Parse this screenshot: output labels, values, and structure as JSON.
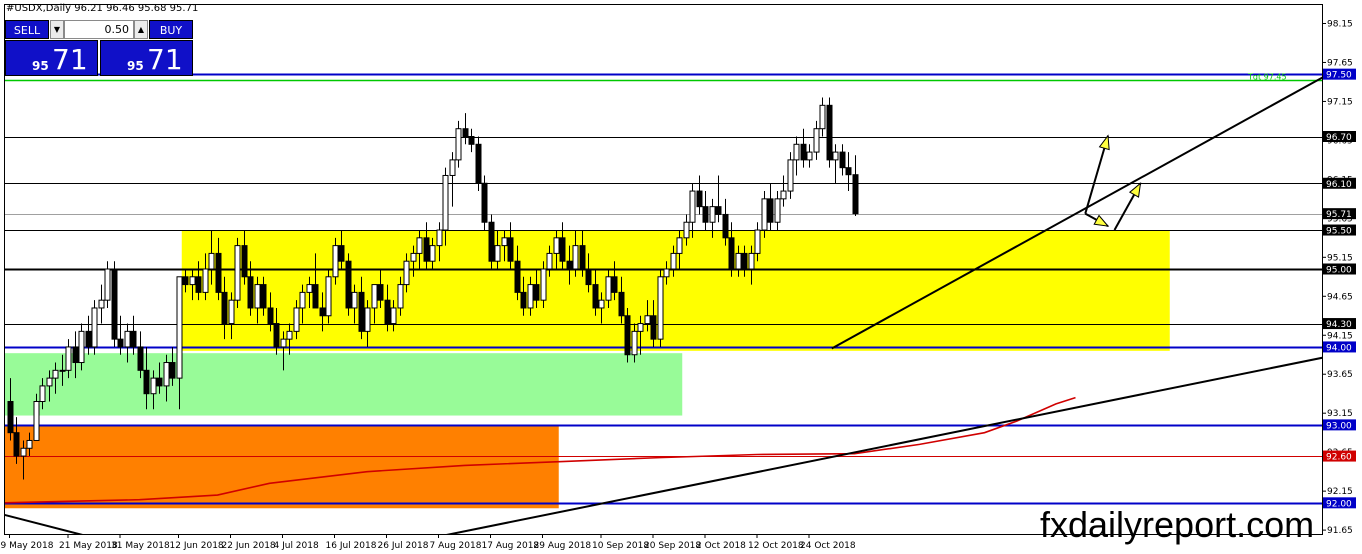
{
  "header": {
    "symbol_info": "#USDX,Daily  96.21 96.46 95.68 95.71"
  },
  "trade_panel": {
    "sell_label": "SELL",
    "buy_label": "BUY",
    "lot_value": "0.50",
    "sell_price_small": "95",
    "sell_price_large": "71",
    "buy_price_small": "95",
    "buy_price_large": "71",
    "down_arrow": "▼",
    "up_arrow": "▲"
  },
  "watermark": "fxdailyreport.com",
  "colors": {
    "yellow_zone": "#ffff00",
    "green_zone": "#98fb98",
    "orange_zone": "#ff8000",
    "blue_line": "#0000c8",
    "red_ma": "#d00000",
    "green_line": "#00c800",
    "arrow_fill": "#ffff40"
  },
  "chart_data": {
    "type": "candlestick",
    "title": "",
    "ylim": [
      91.6,
      98.4
    ],
    "x_labels": [
      {
        "label": "9 May 2018",
        "index": 0
      },
      {
        "label": "21 May 2018",
        "index": 9
      },
      {
        "label": "31 May 2018",
        "index": 17
      },
      {
        "label": "12 Jun 2018",
        "index": 26
      },
      {
        "label": "22 Jun 2018",
        "index": 34
      },
      {
        "label": "4 Jul 2018",
        "index": 42
      },
      {
        "label": "16 Jul 2018",
        "index": 50
      },
      {
        "label": "26 Jul 2018",
        "index": 58
      },
      {
        "label": "7 Aug 2018",
        "index": 66
      },
      {
        "label": "17 Aug 2018",
        "index": 74
      },
      {
        "label": "29 Aug 2018",
        "index": 82
      },
      {
        "label": "10 Sep 2018",
        "index": 91
      },
      {
        "label": "20 Sep 2018",
        "index": 99
      },
      {
        "label": "2 Oct 2018",
        "index": 107
      },
      {
        "label": "12 Oct 2018",
        "index": 115
      },
      {
        "label": "24 Oct 2018",
        "index": 123
      }
    ],
    "y_ticks": [
      98.15,
      97.65,
      97.15,
      96.65,
      96.15,
      95.65,
      95.15,
      94.65,
      94.15,
      93.65,
      93.15,
      92.65,
      92.15,
      91.65
    ],
    "level_lines": [
      {
        "value": 97.5,
        "label": "97.50",
        "color": "#0000c8",
        "width": 2,
        "fill": "#0000c8",
        "text": "#ffffff"
      },
      {
        "value": 96.7,
        "label": "96.70",
        "color": "#000000",
        "width": 1,
        "fill": "#000000",
        "text": "#ffffff"
      },
      {
        "value": 96.1,
        "label": "96.10",
        "color": "#000000",
        "width": 1,
        "fill": "#000000",
        "text": "#ffffff"
      },
      {
        "value": 95.71,
        "label": "95.71",
        "color": "#a0a0a0",
        "width": 1,
        "fill": "#000000",
        "text": "#ffffff"
      },
      {
        "value": 95.5,
        "label": "95.50",
        "color": "#000000",
        "width": 1,
        "fill": "#000000",
        "text": "#ffffff"
      },
      {
        "value": 95.0,
        "label": "95.00",
        "color": "#000000",
        "width": 2,
        "fill": "#000000",
        "text": "#ffffff"
      },
      {
        "value": 94.3,
        "label": "94.30",
        "color": "#000000",
        "width": 1,
        "fill": "#000000",
        "text": "#ffffff"
      },
      {
        "value": 94.0,
        "label": "94.00",
        "color": "#0000c8",
        "width": 2,
        "fill": "#0000c8",
        "text": "#ffffff"
      },
      {
        "value": 93.0,
        "label": "93.00",
        "color": "#0000c8",
        "width": 2,
        "fill": "#0000c8",
        "text": "#ffffff"
      },
      {
        "value": 92.6,
        "label": "92.60",
        "color": "#d00000",
        "width": 1,
        "fill": "#d00000",
        "text": "#ffffff"
      },
      {
        "value": 92.0,
        "label": "92.00",
        "color": "#0000c8",
        "width": 2,
        "fill": "#0000c8",
        "text": "#ffffff"
      }
    ],
    "green_level": {
      "value": 97.43,
      "text": "Tgt 97.45"
    },
    "zones": [
      {
        "name": "yellow",
        "x0": 26.5,
        "x1": 178.5,
        "y0": 93.95,
        "y1": 95.5,
        "color": "#ffff00"
      },
      {
        "name": "green",
        "x0": -1,
        "x1": 103.5,
        "y0": 93.12,
        "y1": 93.92,
        "color": "#98fb98"
      },
      {
        "name": "orange",
        "x0": -1,
        "x1": 84.5,
        "y0": 91.93,
        "y1": 93.0,
        "color": "#ff8000"
      }
    ],
    "trendlines": [
      {
        "x0": 126.5,
        "y0": 93.98,
        "x1": 209,
        "y1": 97.78,
        "color": "#000000"
      },
      {
        "x0": 65,
        "y0": 91.55,
        "x1": 209,
        "y1": 93.98,
        "color": "#000000"
      },
      {
        "x0": -1,
        "y0": 91.85,
        "x1": 13,
        "y1": 91.55,
        "color": "#000000"
      }
    ],
    "moving_average": {
      "color": "#d00000",
      "points": [
        [
          -1,
          92.0
        ],
        [
          20,
          92.04
        ],
        [
          32,
          92.1
        ],
        [
          40,
          92.25
        ],
        [
          55,
          92.4
        ],
        [
          70,
          92.48
        ],
        [
          85,
          92.53
        ],
        [
          100,
          92.58
        ],
        [
          115,
          92.62
        ],
        [
          130,
          92.63
        ],
        [
          140,
          92.75
        ],
        [
          150,
          92.9
        ],
        [
          155,
          93.05
        ],
        [
          161,
          93.27
        ],
        [
          164,
          93.35
        ]
      ]
    },
    "arrows": [
      {
        "from": [
          165.5,
          95.71
        ],
        "to": [
          169,
          96.71
        ]
      },
      {
        "from": [
          165.5,
          95.71
        ],
        "to": [
          169,
          95.55
        ]
      },
      {
        "from": [
          170,
          95.5
        ],
        "to": [
          174,
          96.1
        ]
      }
    ],
    "candles": [
      [
        93.3,
        93.6,
        92.8,
        92.9
      ],
      [
        92.9,
        93.1,
        92.5,
        92.6
      ],
      [
        92.6,
        92.8,
        92.3,
        92.7
      ],
      [
        92.7,
        92.9,
        92.6,
        92.8
      ],
      [
        92.8,
        93.4,
        92.8,
        93.3
      ],
      [
        93.3,
        93.6,
        93.2,
        93.5
      ],
      [
        93.5,
        93.7,
        93.3,
        93.6
      ],
      [
        93.6,
        93.8,
        93.4,
        93.7
      ],
      [
        93.7,
        93.9,
        93.5,
        93.7
      ],
      [
        93.7,
        94.1,
        93.6,
        94.0
      ],
      [
        94.0,
        94.2,
        93.6,
        93.8
      ],
      [
        93.8,
        94.3,
        93.7,
        94.2
      ],
      [
        94.2,
        94.4,
        93.9,
        94.0
      ],
      [
        94.0,
        94.6,
        93.9,
        94.5
      ],
      [
        94.5,
        94.8,
        94.3,
        94.6
      ],
      [
        94.6,
        95.1,
        94.5,
        95.0
      ],
      [
        95.0,
        95.1,
        94.0,
        94.1
      ],
      [
        94.1,
        94.4,
        93.9,
        94.0
      ],
      [
        94.0,
        94.3,
        93.8,
        94.2
      ],
      [
        94.2,
        94.4,
        93.9,
        94.0
      ],
      [
        94.0,
        94.2,
        93.6,
        93.7
      ],
      [
        93.7,
        94.0,
        93.2,
        93.4
      ],
      [
        93.4,
        93.7,
        93.2,
        93.6
      ],
      [
        93.6,
        93.8,
        93.4,
        93.5
      ],
      [
        93.5,
        93.9,
        93.3,
        93.8
      ],
      [
        93.8,
        94.0,
        93.5,
        93.6
      ],
      [
        93.6,
        94.8,
        93.2,
        94.9
      ],
      [
        94.9,
        95.0,
        94.7,
        94.8
      ],
      [
        94.8,
        95.0,
        94.6,
        94.9
      ],
      [
        94.9,
        95.1,
        94.6,
        94.7
      ],
      [
        94.7,
        95.2,
        94.6,
        95.0
      ],
      [
        95.0,
        95.5,
        94.8,
        95.2
      ],
      [
        95.2,
        95.4,
        94.6,
        94.7
      ],
      [
        94.7,
        94.9,
        94.1,
        94.3
      ],
      [
        94.3,
        94.7,
        94.1,
        94.6
      ],
      [
        94.6,
        95.4,
        94.5,
        95.3
      ],
      [
        95.3,
        95.5,
        94.8,
        94.9
      ],
      [
        94.9,
        95.1,
        94.4,
        94.5
      ],
      [
        94.5,
        94.9,
        94.3,
        94.8
      ],
      [
        94.8,
        94.9,
        94.4,
        94.5
      ],
      [
        94.5,
        94.7,
        94.2,
        94.3
      ],
      [
        94.3,
        94.5,
        93.9,
        94.0
      ],
      [
        94.0,
        94.2,
        93.7,
        94.1
      ],
      [
        94.1,
        94.3,
        93.9,
        94.2
      ],
      [
        94.2,
        94.6,
        94.1,
        94.5
      ],
      [
        94.5,
        94.8,
        94.3,
        94.7
      ],
      [
        94.7,
        94.9,
        94.5,
        94.8
      ],
      [
        94.8,
        95.2,
        94.6,
        94.5
      ],
      [
        94.5,
        94.7,
        94.2,
        94.4
      ],
      [
        94.4,
        95.0,
        94.3,
        94.9
      ],
      [
        94.9,
        95.4,
        94.8,
        95.3
      ],
      [
        95.3,
        95.5,
        95.0,
        95.1
      ],
      [
        95.1,
        95.2,
        94.4,
        94.5
      ],
      [
        94.5,
        94.8,
        94.3,
        94.7
      ],
      [
        94.7,
        94.9,
        94.1,
        94.2
      ],
      [
        94.2,
        94.6,
        94.0,
        94.5
      ],
      [
        94.5,
        94.8,
        94.3,
        94.8
      ],
      [
        94.8,
        95.0,
        94.5,
        94.6
      ],
      [
        94.6,
        94.8,
        94.2,
        94.3
      ],
      [
        94.3,
        94.6,
        94.2,
        94.5
      ],
      [
        94.5,
        94.9,
        94.4,
        94.8
      ],
      [
        94.8,
        95.2,
        94.7,
        95.1
      ],
      [
        95.1,
        95.3,
        94.9,
        95.2
      ],
      [
        95.2,
        95.5,
        95.0,
        95.4
      ],
      [
        95.4,
        95.6,
        95.0,
        95.1
      ],
      [
        95.1,
        95.4,
        95.0,
        95.3
      ],
      [
        95.3,
        95.6,
        95.1,
        95.5
      ],
      [
        95.5,
        96.3,
        95.3,
        96.2
      ],
      [
        96.2,
        96.5,
        95.8,
        96.4
      ],
      [
        96.4,
        96.9,
        96.3,
        96.8
      ],
      [
        96.8,
        97.0,
        96.6,
        96.7
      ],
      [
        96.7,
        96.8,
        96.5,
        96.6
      ],
      [
        96.6,
        96.7,
        96.0,
        96.1
      ],
      [
        96.1,
        96.2,
        95.5,
        95.6
      ],
      [
        95.6,
        95.7,
        95.0,
        95.1
      ],
      [
        95.1,
        95.5,
        95.0,
        95.3
      ],
      [
        95.3,
        95.5,
        95.1,
        95.4
      ],
      [
        95.4,
        95.6,
        95.0,
        95.1
      ],
      [
        95.1,
        95.3,
        94.6,
        94.7
      ],
      [
        94.7,
        94.9,
        94.4,
        94.5
      ],
      [
        94.5,
        94.9,
        94.4,
        94.8
      ],
      [
        94.8,
        95.0,
        94.5,
        94.6
      ],
      [
        94.6,
        95.1,
        94.5,
        95.0
      ],
      [
        95.0,
        95.3,
        94.9,
        95.2
      ],
      [
        95.2,
        95.5,
        95.0,
        95.4
      ],
      [
        95.4,
        95.6,
        95.0,
        95.1
      ],
      [
        95.1,
        95.3,
        94.8,
        95.0
      ],
      [
        95.0,
        95.5,
        94.9,
        95.3
      ],
      [
        95.3,
        95.5,
        94.9,
        95.0
      ],
      [
        95.0,
        95.2,
        94.7,
        94.8
      ],
      [
        94.8,
        95.0,
        94.4,
        94.5
      ],
      [
        94.5,
        94.7,
        94.3,
        94.6
      ],
      [
        94.6,
        95.0,
        94.5,
        94.9
      ],
      [
        94.9,
        95.1,
        94.6,
        94.7
      ],
      [
        94.7,
        94.9,
        94.3,
        94.4
      ],
      [
        94.4,
        94.5,
        93.8,
        93.9
      ],
      [
        93.9,
        94.3,
        93.8,
        94.2
      ],
      [
        94.2,
        94.4,
        93.9,
        94.3
      ],
      [
        94.3,
        94.6,
        94.2,
        94.4
      ],
      [
        94.4,
        94.6,
        94.0,
        94.1
      ],
      [
        94.1,
        95.0,
        94.0,
        94.9
      ],
      [
        94.9,
        95.1,
        94.8,
        95.0
      ],
      [
        95.0,
        95.3,
        94.9,
        95.2
      ],
      [
        95.2,
        95.5,
        95.0,
        95.4
      ],
      [
        95.4,
        95.7,
        95.3,
        95.6
      ],
      [
        95.6,
        96.1,
        95.4,
        96.0
      ],
      [
        96.0,
        96.2,
        95.7,
        95.8
      ],
      [
        95.8,
        96.0,
        95.5,
        95.6
      ],
      [
        95.6,
        95.9,
        95.4,
        95.8
      ],
      [
        95.8,
        96.2,
        95.6,
        95.7
      ],
      [
        95.7,
        95.9,
        95.3,
        95.4
      ],
      [
        95.4,
        95.6,
        94.9,
        95.0
      ],
      [
        95.0,
        95.3,
        94.9,
        95.2
      ],
      [
        95.2,
        95.3,
        94.9,
        95.0
      ],
      [
        95.0,
        95.3,
        94.8,
        95.2
      ],
      [
        95.2,
        95.6,
        95.1,
        95.5
      ],
      [
        95.5,
        96.0,
        95.4,
        95.9
      ],
      [
        95.9,
        96.1,
        95.5,
        95.6
      ],
      [
        95.6,
        96.0,
        95.5,
        95.9
      ],
      [
        95.9,
        96.2,
        95.8,
        96.0
      ],
      [
        96.0,
        96.5,
        95.9,
        96.4
      ],
      [
        96.4,
        96.7,
        96.2,
        96.6
      ],
      [
        96.6,
        96.8,
        96.3,
        96.4
      ],
      [
        96.4,
        96.6,
        96.3,
        96.5
      ],
      [
        96.5,
        96.9,
        96.4,
        96.8
      ],
      [
        96.8,
        97.2,
        96.7,
        97.1
      ],
      [
        97.1,
        97.2,
        96.3,
        96.4
      ],
      [
        96.4,
        96.6,
        96.1,
        96.5
      ],
      [
        96.5,
        96.6,
        96.2,
        96.3
      ],
      [
        96.3,
        96.5,
        96.0,
        96.21
      ],
      [
        96.21,
        96.46,
        95.68,
        95.71
      ]
    ]
  }
}
